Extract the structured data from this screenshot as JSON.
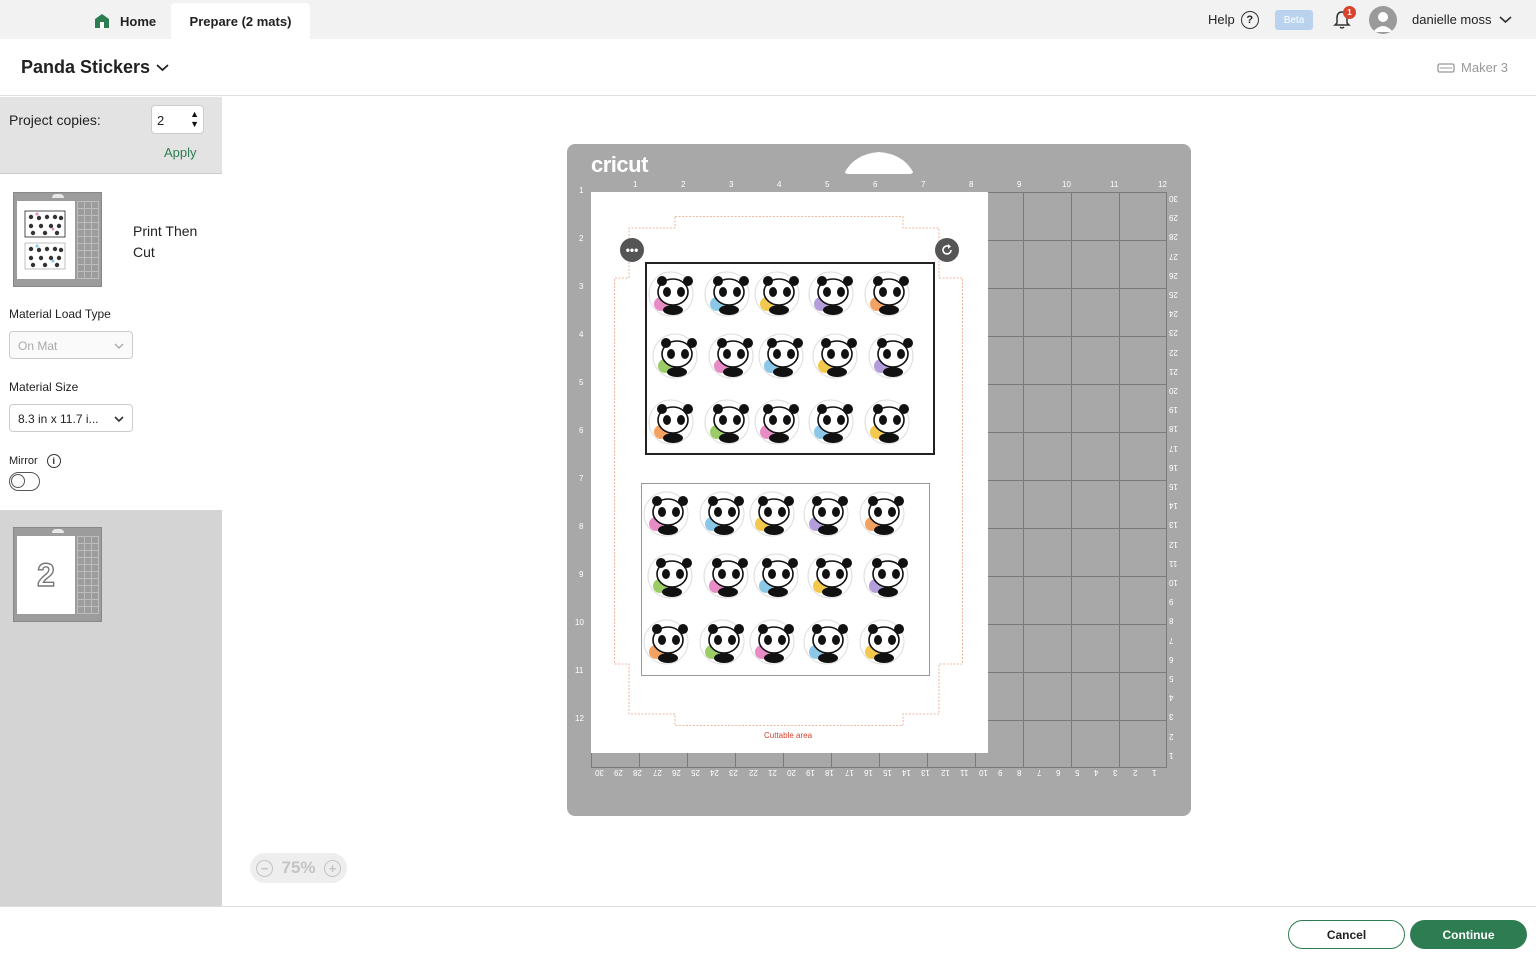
{
  "topbar": {
    "tabs": [
      {
        "label": "Home"
      },
      {
        "label": "Prepare (2 mats)"
      }
    ],
    "help_label": "Help",
    "beta_label": "Beta",
    "notification_count": "1",
    "username": "danielle moss"
  },
  "project": {
    "title": "Panda Stickers",
    "machine": "Maker 3"
  },
  "panel": {
    "copies_label": "Project copies:",
    "copies_value": "2",
    "apply_label": "Apply",
    "mat1_label": "Print Then Cut",
    "material_load_label": "Material Load Type",
    "material_load_value": "On Mat",
    "material_size_label": "Material Size",
    "material_size_value": "8.3 in x 11.7 i...",
    "mirror_label": "Mirror",
    "mat2_number": "2"
  },
  "mat": {
    "brand": "cricut",
    "top_ruler": [
      "1",
      "2",
      "3",
      "4",
      "5",
      "6",
      "7",
      "8",
      "9",
      "10",
      "11",
      "12"
    ],
    "left_ruler": [
      "1",
      "2",
      "3",
      "4",
      "5",
      "6",
      "7",
      "8",
      "9",
      "10",
      "11",
      "12"
    ],
    "right_ruler": [
      "30",
      "29",
      "28",
      "27",
      "26",
      "25",
      "24",
      "23",
      "22",
      "21",
      "20",
      "19",
      "18",
      "17",
      "16",
      "15",
      "14",
      "13",
      "12",
      "11",
      "10",
      "9",
      "8",
      "7",
      "6",
      "5",
      "4",
      "3",
      "2",
      "1"
    ],
    "bottom_ruler": [
      "30",
      "29",
      "28",
      "27",
      "26",
      "25",
      "24",
      "23",
      "22",
      "21",
      "20",
      "19",
      "18",
      "17",
      "16",
      "15",
      "14",
      "13",
      "12",
      "11",
      "10",
      "9",
      "8",
      "7",
      "6",
      "5",
      "4",
      "3",
      "2",
      "1"
    ],
    "cuttable_label": "Cuttable area"
  },
  "zoom": {
    "level": "75%"
  },
  "footer": {
    "cancel_label": "Cancel",
    "continue_label": "Continue"
  },
  "colors": {
    "accent": "#2e7d52",
    "mat_gray": "#a8a8a8",
    "cut_line": "#d6432e"
  }
}
